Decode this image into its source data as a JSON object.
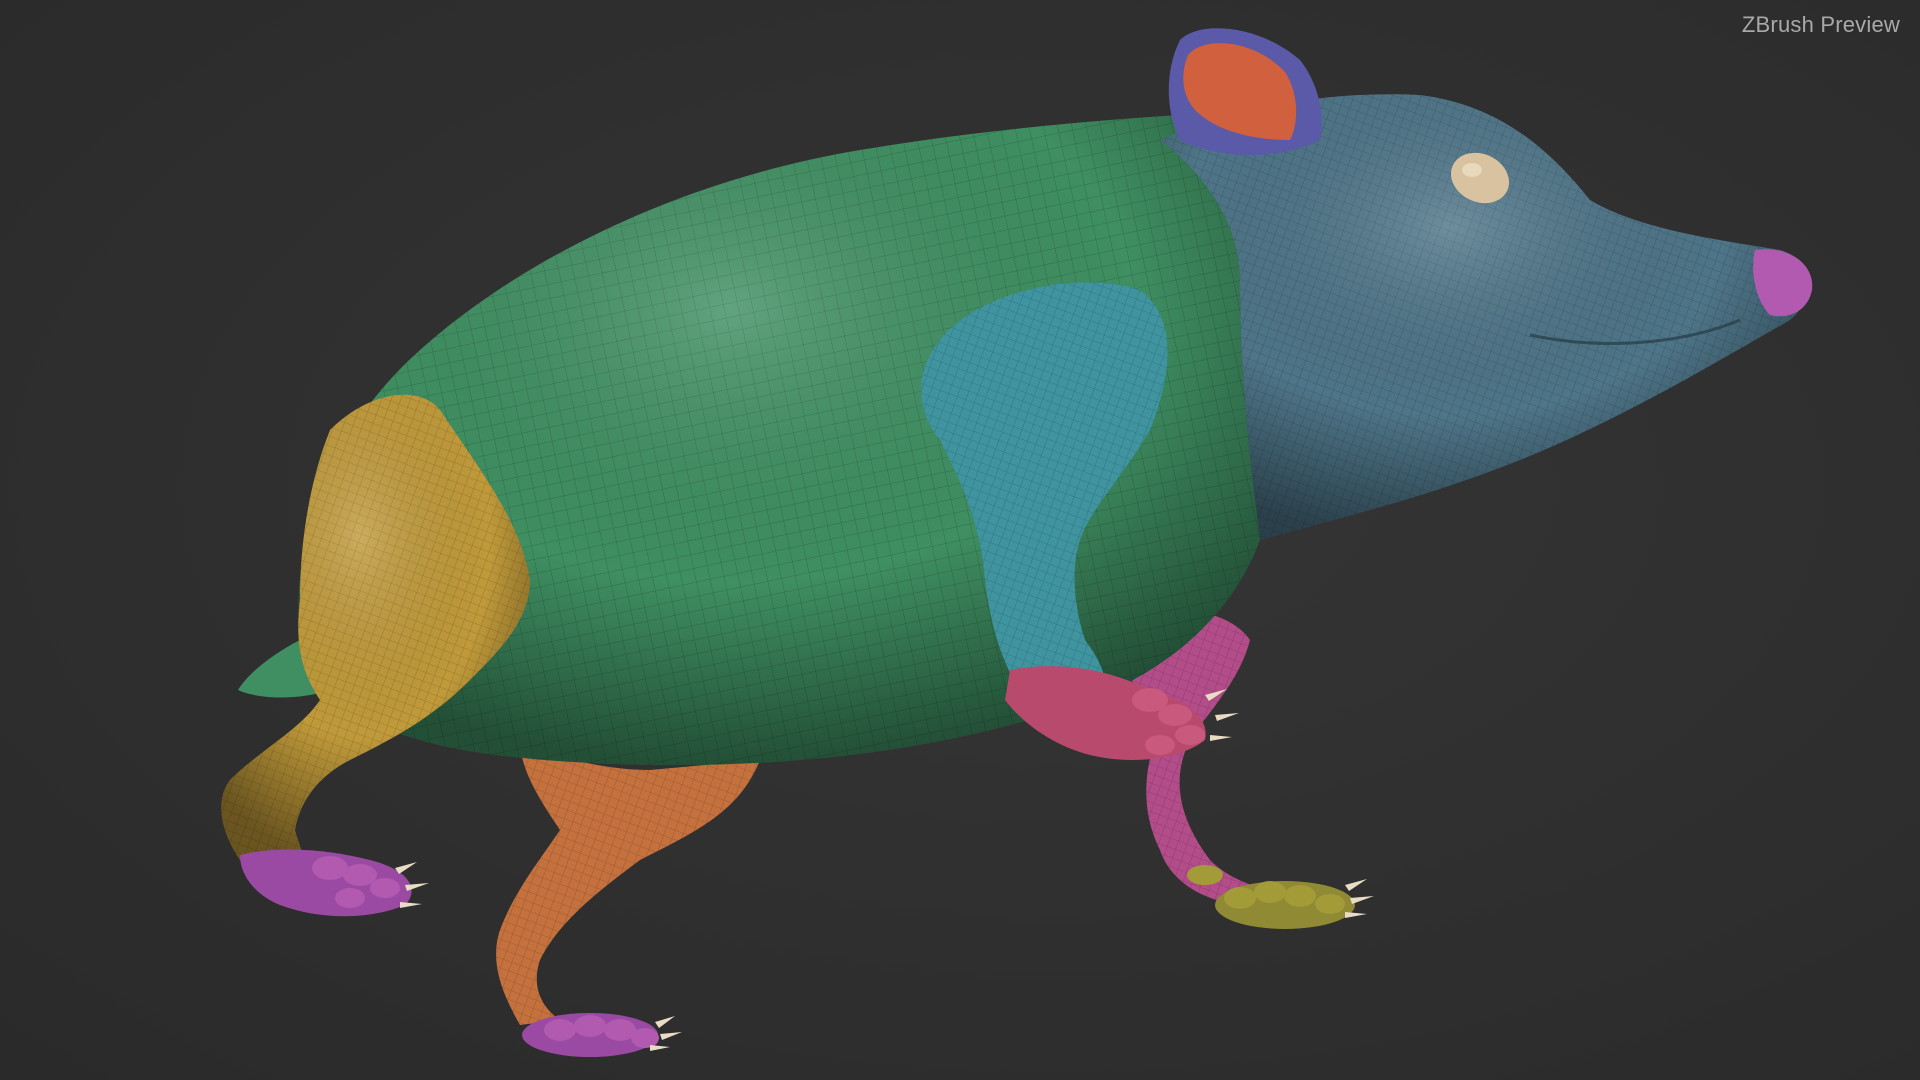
{
  "viewport": {
    "watermark": "ZBrush Preview",
    "background": "#2e2e2e"
  },
  "model": {
    "subject": "rodent-sculpt",
    "polygroup_colors": {
      "body": "#3f8f62",
      "head": "#4e7588",
      "ear_inner": "#d0603e",
      "ear_rim": "#5a5aa8",
      "eye": "#d8c2a0",
      "nose": "#b25ab0",
      "front_leg_upper": "#3f94a0",
      "hind_leg_near": "#c09a3a",
      "hind_leg_far": "#c4713e",
      "front_leg_far": "#b24d8a",
      "paw_purple": "#9a4aa2",
      "paw_pink": "#b84a6e",
      "paw_olive": "#a39a38",
      "claw": "#e8dcc4"
    }
  }
}
